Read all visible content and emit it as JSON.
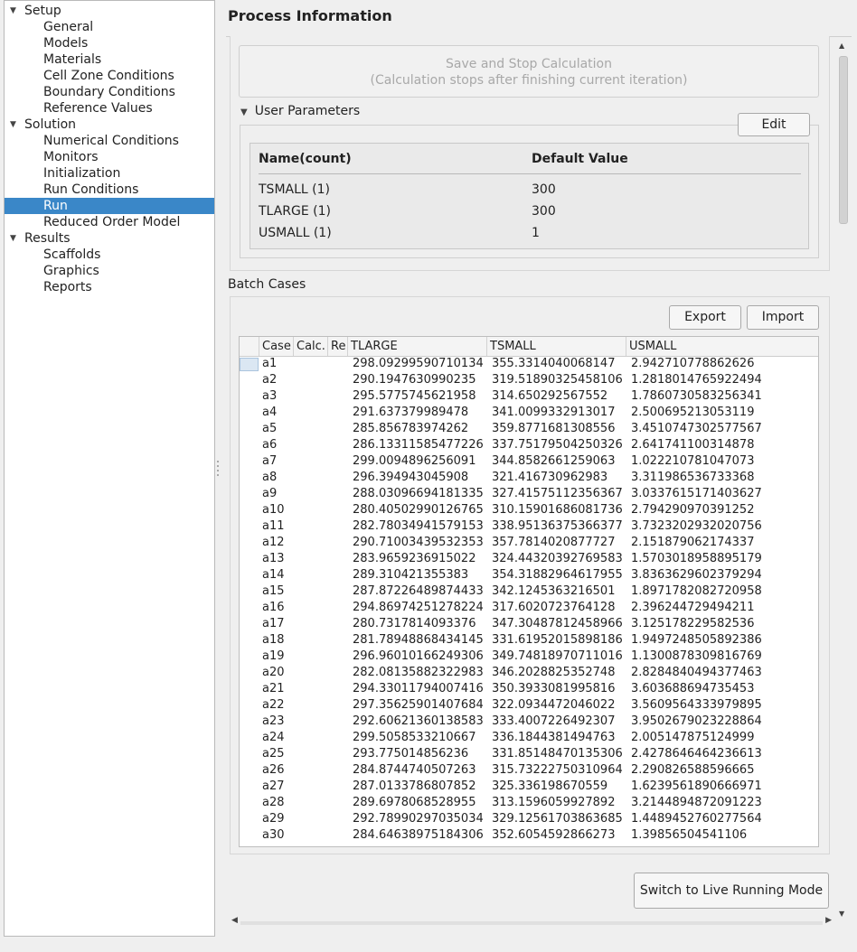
{
  "tree": [
    {
      "label": "Setup",
      "type": "cat"
    },
    {
      "label": "General",
      "type": "leaf"
    },
    {
      "label": "Models",
      "type": "leaf"
    },
    {
      "label": "Materials",
      "type": "leaf"
    },
    {
      "label": "Cell Zone Conditions",
      "type": "leaf"
    },
    {
      "label": "Boundary Conditions",
      "type": "leaf"
    },
    {
      "label": "Reference Values",
      "type": "leaf"
    },
    {
      "label": "Solution",
      "type": "cat"
    },
    {
      "label": "Numerical Conditions",
      "type": "leaf"
    },
    {
      "label": "Monitors",
      "type": "leaf"
    },
    {
      "label": "Initialization",
      "type": "leaf"
    },
    {
      "label": "Run Conditions",
      "type": "leaf"
    },
    {
      "label": "Run",
      "type": "leaf",
      "selected": true
    },
    {
      "label": "Reduced Order Model",
      "type": "leaf"
    },
    {
      "label": "Results",
      "type": "cat"
    },
    {
      "label": "Scaffolds",
      "type": "leaf"
    },
    {
      "label": "Graphics",
      "type": "leaf"
    },
    {
      "label": "Reports",
      "type": "leaf"
    }
  ],
  "page_title": "Process Information",
  "save_stop": {
    "line1": "Save and Stop Calculation",
    "line2": "(Calculation stops after finishing current iteration)"
  },
  "user_params": {
    "title": "User Parameters",
    "edit_label": "Edit",
    "headers": [
      "Name(count)",
      "Default Value"
    ],
    "rows": [
      [
        "TSMALL (1)",
        "300"
      ],
      [
        "TLARGE (1)",
        "300"
      ],
      [
        "USMALL (1)",
        "1"
      ]
    ]
  },
  "batch": {
    "label": "Batch Cases",
    "export_label": "Export",
    "import_label": "Import",
    "headers": [
      "Case",
      "Calc.",
      "Re:",
      "TLARGE",
      "TSMALL",
      "USMALL"
    ],
    "rows": [
      [
        "a1",
        "298.09299590710134",
        "355.3314040068147",
        "2.942710778862626"
      ],
      [
        "a2",
        "290.1947630990235",
        "319.51890325458106",
        "1.2818014765922494"
      ],
      [
        "a3",
        "295.5775745621958",
        "314.650292567552",
        "1.7860730583256341"
      ],
      [
        "a4",
        "291.637379989478",
        "341.0099332913017",
        "2.500695213053119"
      ],
      [
        "a5",
        "285.856783974262",
        "359.8771681308556",
        "3.4510747302577567"
      ],
      [
        "a6",
        "286.13311585477226",
        "337.75179504250326",
        "2.641741100314878"
      ],
      [
        "a7",
        "299.0094896256091",
        "344.8582661259063",
        "1.022210781047073"
      ],
      [
        "a8",
        "296.394943045908",
        "321.416730962983",
        "3.311986536733368"
      ],
      [
        "a9",
        "288.03096694181335",
        "327.41575112356367",
        "3.0337615171403627"
      ],
      [
        "a10",
        "280.40502990126765",
        "310.15901686081736",
        "2.794290970391252"
      ],
      [
        "a11",
        "282.78034941579153",
        "338.95136375366377",
        "3.7323202932020756"
      ],
      [
        "a12",
        "290.71003439532353",
        "357.7814020877727",
        "2.151879062174337"
      ],
      [
        "a13",
        "283.9659236915022",
        "324.44320392769583",
        "1.5703018958895179"
      ],
      [
        "a14",
        "289.310421355383",
        "354.31882964617955",
        "3.8363629602379294"
      ],
      [
        "a15",
        "287.87226489874433",
        "342.1245363216501",
        "1.8971782082720958"
      ],
      [
        "a16",
        "294.86974251278224",
        "317.6020723764128",
        "2.396244729494211"
      ],
      [
        "a17",
        "280.7317814093376",
        "347.30487812458966",
        "3.125178229582536"
      ],
      [
        "a18",
        "281.78948868434145",
        "331.61952015898186",
        "1.9497248505892386"
      ],
      [
        "a19",
        "296.96010166249306",
        "349.74818970711016",
        "1.1300878309816769"
      ],
      [
        "a20",
        "282.08135882322983",
        "346.2028825352748",
        "2.8284840494377463"
      ],
      [
        "a21",
        "294.33011794007416",
        "350.3933081995816",
        "3.603688694735453"
      ],
      [
        "a22",
        "297.35625901407684",
        "322.0934472046022",
        "3.5609564333979895"
      ],
      [
        "a23",
        "292.60621360138583",
        "333.4007226492307",
        "3.9502679023228864"
      ],
      [
        "a24",
        "299.5058533210667",
        "336.1844381494763",
        "2.005147875124999"
      ],
      [
        "a25",
        "293.775014856236",
        "331.85148470135306",
        "2.4278646464236613"
      ],
      [
        "a26",
        "284.8744740507263",
        "315.73222750310964",
        "2.290826588596665"
      ],
      [
        "a27",
        "287.0133786807852",
        "325.336198670559",
        "1.6239561890666971"
      ],
      [
        "a28",
        "289.6978068528955",
        "313.1596059927892",
        "3.2144894872091223"
      ],
      [
        "a29",
        "292.78990297035034",
        "329.12561703863685",
        "1.4489452760277564"
      ],
      [
        "a30",
        "284.64638975184306",
        "352.6054592866273",
        "1.39856504541106"
      ]
    ]
  },
  "live_mode_label": "Switch to Live Running Mode",
  "icons": {
    "expanded": "triangle-down-icon",
    "scroll_up": "arrow-up-icon",
    "scroll_down": "arrow-down-icon",
    "scroll_left": "arrow-left-icon",
    "scroll_right": "arrow-right-icon"
  },
  "colors": {
    "selection": "#3a87c8",
    "disabled_text": "#a8a8a8"
  }
}
